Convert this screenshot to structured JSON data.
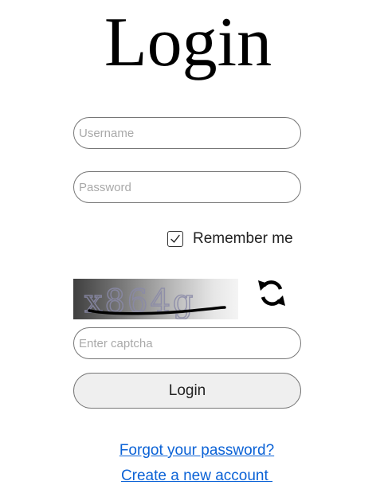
{
  "page": {
    "title": "Login"
  },
  "form": {
    "username_placeholder": "Username",
    "password_placeholder": "Password",
    "remember_label": "Remember me",
    "remember_checked": true,
    "captcha_text": "x864g",
    "captcha_placeholder": "Enter captcha",
    "login_label": "Login"
  },
  "links": {
    "forgot_password": "Forgot your password?",
    "create_account": "Create a new account "
  },
  "colors": {
    "link": "#0b62d6",
    "button_bg": "#efefef",
    "field_border": "#767676"
  },
  "icons": {
    "refresh": "refresh-icon",
    "checkmark": "checkmark-icon"
  }
}
